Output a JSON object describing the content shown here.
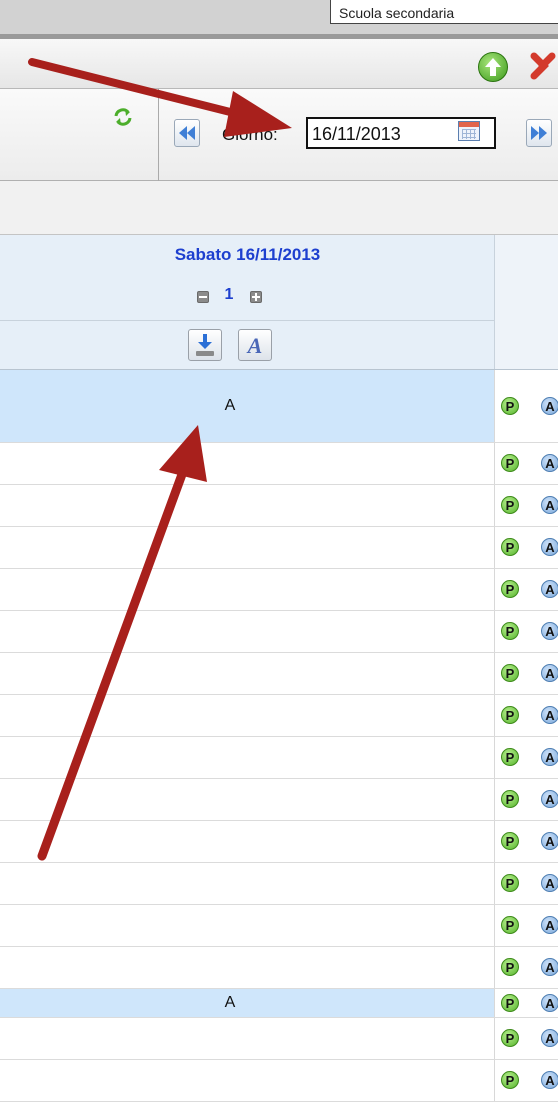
{
  "topbar": {
    "partial_text": "Scuola secondaria"
  },
  "toolbar": {
    "go_up_icon": "green-up-arrow-icon",
    "close_icon": "red-x-icon",
    "refresh_icon": "refresh-icon"
  },
  "nav": {
    "giorno_label": "Giorno:",
    "date_value": "16/11/2013",
    "prev_icon": "double-left-arrow-icon",
    "next_icon": "double-right-arrow-icon",
    "calendar_icon": "calendar-icon"
  },
  "column": {
    "day_label": "Sabato 16/11/2013",
    "count": "1",
    "download_icon": "download-icon",
    "font_icon": "font-italic-A-icon",
    "font_glyph": "A"
  },
  "rows": [
    {
      "mark": "A",
      "p": "P",
      "a": "A"
    },
    {
      "mark": "",
      "p": "P",
      "a": "A"
    },
    {
      "mark": "",
      "p": "P",
      "a": "A"
    },
    {
      "mark": "",
      "p": "P",
      "a": "A"
    },
    {
      "mark": "",
      "p": "P",
      "a": "A"
    },
    {
      "mark": "",
      "p": "P",
      "a": "A"
    },
    {
      "mark": "",
      "p": "P",
      "a": "A"
    },
    {
      "mark": "",
      "p": "P",
      "a": "A"
    },
    {
      "mark": "",
      "p": "P",
      "a": "A"
    },
    {
      "mark": "",
      "p": "P",
      "a": "A"
    },
    {
      "mark": "",
      "p": "P",
      "a": "A"
    },
    {
      "mark": "",
      "p": "P",
      "a": "A"
    },
    {
      "mark": "",
      "p": "P",
      "a": "A"
    },
    {
      "mark": "",
      "p": "P",
      "a": "A"
    },
    {
      "mark": "A",
      "p": "P",
      "a": "A"
    },
    {
      "mark": "",
      "p": "P",
      "a": "A"
    },
    {
      "mark": "",
      "p": "P",
      "a": "A"
    }
  ],
  "colors": {
    "highlight_row": "#cfe6fb",
    "day_header": "#1d3fcf",
    "annotation_arrow": "#a8201c"
  }
}
